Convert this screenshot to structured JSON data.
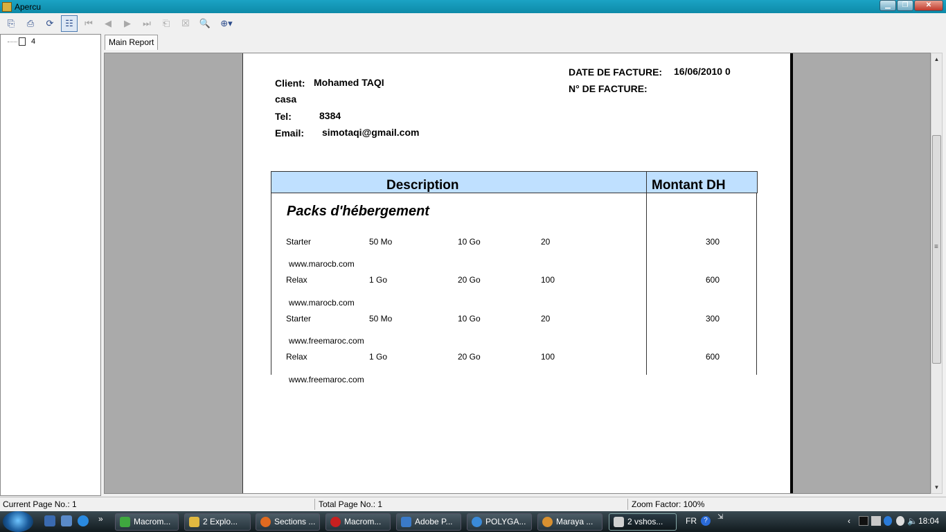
{
  "window": {
    "title": "Apercu"
  },
  "tree": {
    "node_label": "4"
  },
  "tabs": {
    "main": "Main Report"
  },
  "report": {
    "client_label": "Client:",
    "client_name": "Mohamed TAQI",
    "city": "casa",
    "tel_label": "Tel:",
    "tel_value": "8384",
    "email_label": "Email:",
    "email_value": "simotaqi@gmail.com",
    "date_label": "DATE DE FACTURE:",
    "date_value": "16/06/2010  0",
    "number_label": "N° DE FACTURE:",
    "col_description": "Description",
    "col_amount": "Montant   DH",
    "section_title": "Packs d'hébergement",
    "rows": [
      {
        "name": "Starter",
        "space": "50 Mo",
        "traffic": "10 Go",
        "qty": "20",
        "amount": "300",
        "domain": "www.marocb.com"
      },
      {
        "name": "Relax",
        "space": "1 Go",
        "traffic": "20 Go",
        "qty": "100",
        "amount": "600",
        "domain": "www.marocb.com"
      },
      {
        "name": "Starter",
        "space": "50 Mo",
        "traffic": "10 Go",
        "qty": "20",
        "amount": "300",
        "domain": "www.freemaroc.com"
      },
      {
        "name": "Relax",
        "space": "1 Go",
        "traffic": "20 Go",
        "qty": "100",
        "amount": "600",
        "domain": "www.freemaroc.com"
      }
    ]
  },
  "status": {
    "current_page": "Current Page No.: 1",
    "total_page": "Total Page No.: 1",
    "zoom": "Zoom Factor: 100%"
  },
  "taskbar": {
    "tasks": [
      {
        "label": "Macrom...",
        "color": "#3fa83f"
      },
      {
        "label": "2 Explo...",
        "color": "#e0b840"
      },
      {
        "label": "Sections ...",
        "color": "#e06a20"
      },
      {
        "label": "Macrom...",
        "color": "#c82020"
      },
      {
        "label": "Adobe P...",
        "color": "#3a7ac8"
      },
      {
        "label": "POLYGA...",
        "color": "#3a8ad8"
      },
      {
        "label": "Maraya ...",
        "color": "#d89030"
      },
      {
        "label": "2 vshos...",
        "color": "#d0d0d0"
      }
    ],
    "lang": "FR",
    "clock": "18:04"
  }
}
